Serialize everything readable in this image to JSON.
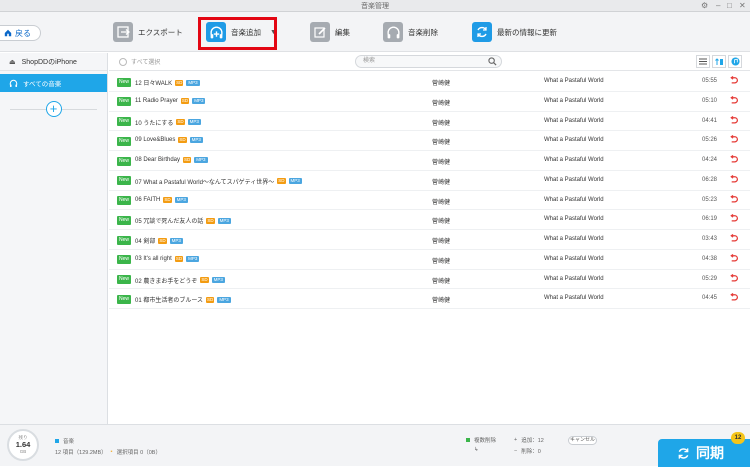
{
  "window": {
    "title": "音楽管理"
  },
  "toolbar": {
    "back_label": "戻る",
    "export_label": "エクスポート",
    "add_music_label": "音楽追加",
    "edit_label": "編集",
    "delete_label": "音楽削除",
    "refresh_label": "最新の情報に更新"
  },
  "sidebar": {
    "device_name": "ShopDDのiPhone",
    "all_music_label": "すべての音楽"
  },
  "list": {
    "select_all_label": "すべて選択",
    "search_placeholder": "検索",
    "rows": [
      {
        "new": "New",
        "title": "12 日々WALK",
        "b1": "SD",
        "b2": "MP3",
        "artist": "菅崎健",
        "album": "What a Pastaful World",
        "duration": "05:55"
      },
      {
        "new": "New",
        "title": "11 Radio Prayer",
        "b1": "SD",
        "b2": "MP3",
        "artist": "菅崎健",
        "album": "What a Pastaful World",
        "duration": "05:10"
      },
      {
        "new": "New",
        "title": "10 うたにする",
        "b1": "SD",
        "b2": "MP3",
        "artist": "菅崎健",
        "album": "What a Pastaful World",
        "duration": "04:41"
      },
      {
        "new": "New",
        "title": "09 Love&Blues",
        "b1": "SD",
        "b2": "MP3",
        "artist": "菅崎健",
        "album": "What a Pastaful World",
        "duration": "05:26"
      },
      {
        "new": "New",
        "title": "08 Dear Birthday",
        "b1": "SD",
        "b2": "MP3",
        "artist": "菅崎健",
        "album": "What a Pastaful World",
        "duration": "04:24"
      },
      {
        "new": "New",
        "title": "07 What a Pastaful World～なんてスパゲティ世界～",
        "b1": "SD",
        "b2": "MP3",
        "artist": "菅崎健",
        "album": "What a Pastaful World",
        "duration": "06:28"
      },
      {
        "new": "New",
        "title": "06 FAITH",
        "b1": "SD",
        "b2": "MP3",
        "artist": "菅崎健",
        "album": "What a Pastaful World",
        "duration": "05:23"
      },
      {
        "new": "New",
        "title": "05 冗談で死んだ友人の話",
        "b1": "SD",
        "b2": "MP3",
        "artist": "菅崎健",
        "album": "What a Pastaful World",
        "duration": "06:19"
      },
      {
        "new": "New",
        "title": "04 剣部",
        "b1": "SD",
        "b2": "MP3",
        "artist": "菅崎健",
        "album": "What a Pastaful World",
        "duration": "03:43"
      },
      {
        "new": "New",
        "title": "03 It's all right",
        "b1": "SD",
        "b2": "MP3",
        "artist": "菅崎健",
        "album": "What a Pastaful World",
        "duration": "04:38"
      },
      {
        "new": "New",
        "title": "02 農きまお手をどうぞ",
        "b1": "SD",
        "b2": "MP3",
        "artist": "菅崎健",
        "album": "What a Pastaful World",
        "duration": "05:29"
      },
      {
        "new": "New",
        "title": "01 都市生活者のブルース",
        "b1": "SD",
        "b2": "MP3",
        "artist": "菅崎健",
        "album": "What a Pastaful World",
        "duration": "04:45"
      }
    ]
  },
  "bottom": {
    "storage_label": "残り",
    "storage_value": "1.64",
    "storage_unit": "GB",
    "music_label": "音楽",
    "items_text": "12 項目（129.2MB）",
    "selected_text": "選択項目 0（0B）",
    "dup_delete_label": "複数削除",
    "add_text": "追加：12",
    "remove_text": "削除：0",
    "cancel_label": "キャンセル",
    "sync_label": "同期",
    "sync_badge": "12"
  },
  "colors": {
    "accent": "#1fa6e8",
    "new_badge": "#3bb54a",
    "highlight": "#e30613",
    "undo": "#e53935"
  }
}
